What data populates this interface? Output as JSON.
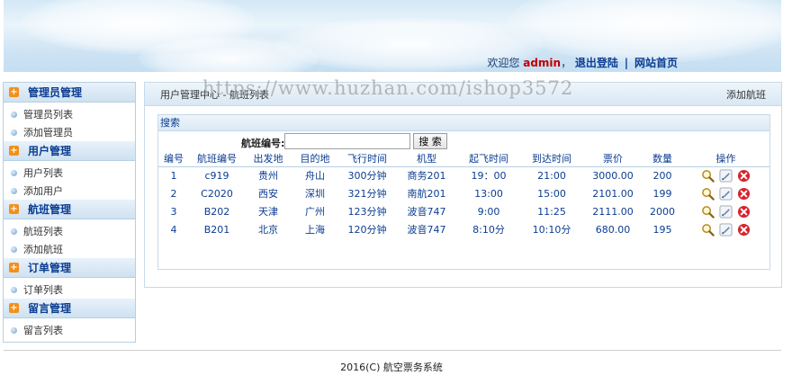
{
  "header": {
    "welcome": "欢迎您",
    "username": "admin",
    "logout": "退出登陆",
    "separator": "|",
    "home": "网站首页"
  },
  "watermark": "https://www.huzhan.com/ishop3572",
  "sidebar": {
    "groups": [
      {
        "title": "管理员管理",
        "items": [
          "管理员列表",
          "添加管理员"
        ]
      },
      {
        "title": "用户管理",
        "items": [
          "用户列表",
          "添加用户"
        ]
      },
      {
        "title": "航班管理",
        "items": [
          "航班列表",
          "添加航班"
        ]
      },
      {
        "title": "订单管理",
        "items": [
          "订单列表"
        ]
      },
      {
        "title": "留言管理",
        "items": [
          "留言列表"
        ]
      }
    ]
  },
  "main": {
    "breadcrumb": "用户管理中心 - 航班列表",
    "add_label": "添加航班",
    "panel_title": "搜索",
    "search_label": "航班编号:",
    "search_value": "",
    "search_button": "搜 索",
    "columns": [
      "编号",
      "航班编号",
      "出发地",
      "目的地",
      "飞行时间",
      "机型",
      "起飞时间",
      "到达时间",
      "票价",
      "数量",
      "操作"
    ],
    "rows": [
      [
        "1",
        "c919",
        "贵州",
        "舟山",
        "300分钟",
        "商务201",
        "19：00",
        "21:00",
        "3000.00",
        "200"
      ],
      [
        "2",
        "C2020",
        "西安",
        "深圳",
        "321分钟",
        "南航201",
        "13:00",
        "15:00",
        "2101.00",
        "199"
      ],
      [
        "3",
        "B202",
        "天津",
        "广州",
        "123分钟",
        "波音747",
        "9:00",
        "11:25",
        "2111.00",
        "2000"
      ],
      [
        "4",
        "B201",
        "北京",
        "上海",
        "120分钟",
        "波音747",
        "8:10分",
        "10:10分",
        "680.00",
        "195"
      ]
    ]
  },
  "footer": "2016(C) 航空票务系统"
}
